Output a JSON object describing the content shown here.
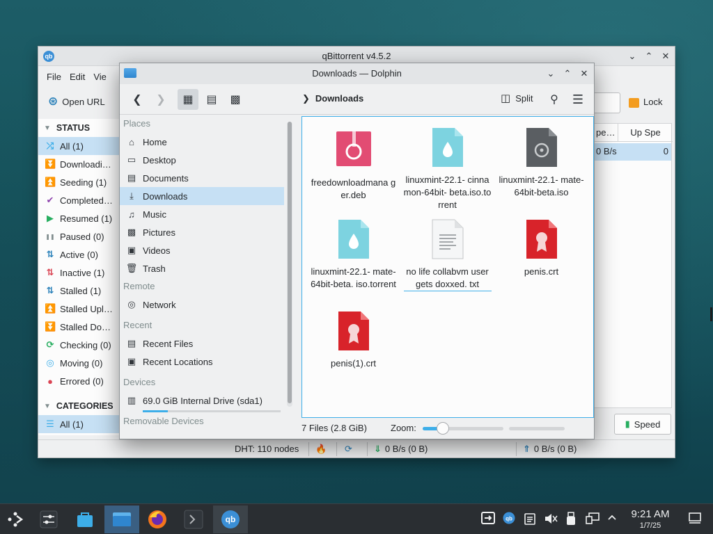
{
  "qbittorrent": {
    "title": "qBittorrent v4.5.2",
    "menu": [
      "File",
      "Edit",
      "Vie"
    ],
    "toolbar": {
      "open_url": "Open URL",
      "lock": "Lock"
    },
    "status_header": "STATUS",
    "status_filters": [
      {
        "label": "All (1)",
        "icon": "shuffle-icon",
        "color": "#3daee9"
      },
      {
        "label": "Downloadi…",
        "icon": "double-chevron-down-icon",
        "color": "#27ae60"
      },
      {
        "label": "Seeding (1)",
        "icon": "double-chevron-up-icon",
        "color": "#2980b9"
      },
      {
        "label": "Completed…",
        "icon": "checkmark-icon",
        "color": "#8e44ad"
      },
      {
        "label": "Resumed (1)",
        "icon": "play-icon",
        "color": "#27ae60"
      },
      {
        "label": "Paused (0)",
        "icon": "pause-icon",
        "color": "#7f8c8d"
      },
      {
        "label": "Active (0)",
        "icon": "up-down-arrows-icon",
        "color": "#2980b9"
      },
      {
        "label": "Inactive (1)",
        "icon": "up-down-arrows-icon",
        "color": "#da4453"
      },
      {
        "label": "Stalled (1)",
        "icon": "up-down-arrows-icon",
        "color": "#2980b9"
      },
      {
        "label": "Stalled Upl…",
        "icon": "double-chevron-up-icon",
        "color": "#3daee9"
      },
      {
        "label": "Stalled Do…",
        "icon": "double-chevron-down-icon",
        "color": "#27ae60"
      },
      {
        "label": "Checking (0)",
        "icon": "refresh-icon",
        "color": "#27ae60"
      },
      {
        "label": "Moving (0)",
        "icon": "target-icon",
        "color": "#3daee9"
      },
      {
        "label": "Errored (0)",
        "icon": "error-icon",
        "color": "#da4453"
      }
    ],
    "categories_header": "CATEGORIES",
    "categories": [
      {
        "label": "All (1)"
      }
    ],
    "columns": {
      "down_speed": "pe…",
      "up_speed": "Up Spe"
    },
    "row": {
      "down_speed": "0 B/s",
      "up_speed": "0"
    },
    "speed_button": "Speed",
    "statusbar": {
      "dht": "DHT: 110 nodes",
      "down": "0 B/s (0 B)",
      "up": "0 B/s (0 B)"
    }
  },
  "dolphin": {
    "title": "Downloads — Dolphin",
    "breadcrumb": "Downloads",
    "split_label": "Split",
    "places": {
      "places_header": "Places",
      "places_items": [
        {
          "label": "Home",
          "icon": "home-icon"
        },
        {
          "label": "Desktop",
          "icon": "desktop-icon"
        },
        {
          "label": "Documents",
          "icon": "documents-icon"
        },
        {
          "label": "Downloads",
          "icon": "downloads-icon",
          "selected": true
        },
        {
          "label": "Music",
          "icon": "music-icon"
        },
        {
          "label": "Pictures",
          "icon": "pictures-icon"
        },
        {
          "label": "Videos",
          "icon": "videos-icon"
        },
        {
          "label": "Trash",
          "icon": "trash-icon"
        }
      ],
      "remote_header": "Remote",
      "remote_items": [
        {
          "label": "Network",
          "icon": "network-icon"
        }
      ],
      "recent_header": "Recent",
      "recent_items": [
        {
          "label": "Recent Files",
          "icon": "recent-files-icon"
        },
        {
          "label": "Recent Locations",
          "icon": "recent-locations-icon"
        }
      ],
      "devices_header": "Devices",
      "devices_items": [
        {
          "label": "69.0 GiB Internal Drive (sda1)",
          "icon": "drive-icon"
        }
      ],
      "drive_usage_fraction": 0.18,
      "removable_header": "Removable Devices"
    },
    "files": [
      {
        "name": "freedownloadmana ger.deb",
        "type": "deb"
      },
      {
        "name": "linuxmint-22.1- cinnamon-64bit- beta.iso.torrent",
        "type": "torrent"
      },
      {
        "name": "linuxmint-22.1- mate-64bit-beta.iso",
        "type": "iso"
      },
      {
        "name": "linuxmint-22.1- mate-64bit-beta. iso.torrent",
        "type": "torrent"
      },
      {
        "name": "no life collabvm user gets doxxed. txt",
        "type": "txt",
        "focused": true
      },
      {
        "name": "penis.crt",
        "type": "crt"
      },
      {
        "name": "penis(1).crt",
        "type": "crt"
      }
    ],
    "status": {
      "summary": "7 Files (2.8 GiB)",
      "zoom_label": "Zoom:",
      "zoom_fraction": 0.25
    }
  },
  "taskbar": {
    "apps": [
      {
        "name": "app-launcher-icon"
      },
      {
        "name": "system-settings-icon"
      },
      {
        "name": "discover-store-icon"
      },
      {
        "name": "dolphin-taskbar-icon",
        "state": "active"
      },
      {
        "name": "firefox-taskbar-icon"
      },
      {
        "name": "konsole-taskbar-icon"
      },
      {
        "name": "qbittorrent-taskbar-icon",
        "state": "open"
      }
    ],
    "clock": {
      "time": "9:21 AM",
      "date": "1/7/25"
    }
  }
}
